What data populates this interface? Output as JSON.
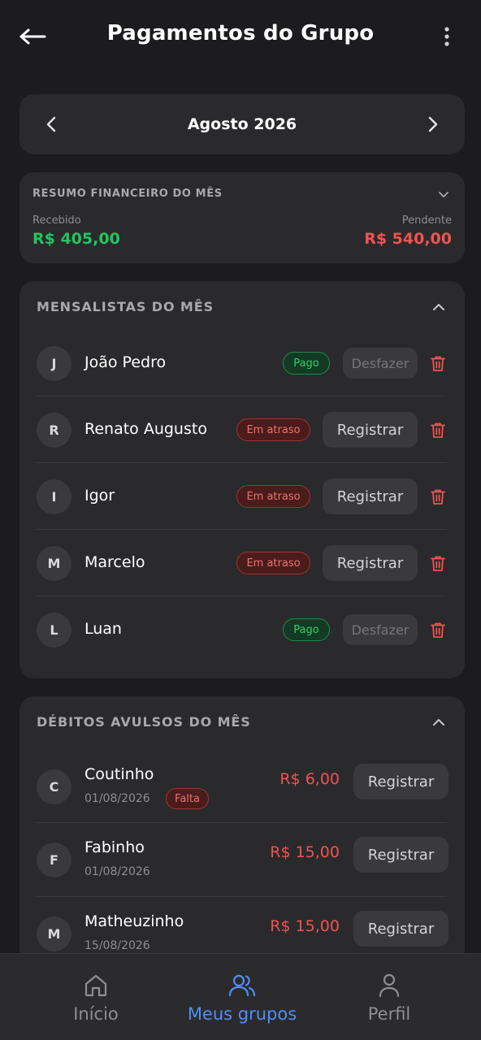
{
  "header": {
    "title": "Pagamentos do Grupo"
  },
  "month": {
    "label": "Agosto 2026"
  },
  "summary": {
    "title": "RESUMO FINANCEIRO DO MÊS",
    "received_label": "Recebido",
    "received_value": "R$ 405,00",
    "pending_label": "Pendente",
    "pending_value": "R$ 540,00"
  },
  "mensalistas": {
    "title": "MENSALISTAS DO MÊS",
    "members": [
      {
        "initial": "J",
        "name": "João Pedro",
        "status": "Pago",
        "action": "Desfazer"
      },
      {
        "initial": "R",
        "name": "Renato Augusto",
        "status": "Em atraso",
        "action": "Registrar"
      },
      {
        "initial": "I",
        "name": "Igor",
        "status": "Em atraso",
        "action": "Registrar"
      },
      {
        "initial": "M",
        "name": "Marcelo",
        "status": "Em atraso",
        "action": "Registrar"
      },
      {
        "initial": "L",
        "name": "Luan",
        "status": "Pago",
        "action": "Desfazer"
      }
    ]
  },
  "debitos": {
    "title": "DÉBITOS AVULSOS DO MÊS",
    "items": [
      {
        "initial": "C",
        "name": "Coutinho",
        "date": "01/08/2026",
        "tag": "Falta",
        "amount": "R$ 6,00",
        "action": "Registrar"
      },
      {
        "initial": "F",
        "name": "Fabinho",
        "date": "01/08/2026",
        "amount": "R$ 15,00",
        "action": "Registrar"
      },
      {
        "initial": "M",
        "name": "Matheuzinho",
        "date": "15/08/2026",
        "amount": "R$ 15,00",
        "action": "Registrar"
      }
    ]
  },
  "bottom_nav": {
    "items": [
      {
        "label": "Início",
        "icon": "home-icon"
      },
      {
        "label": "Meus grupos",
        "icon": "users-icon",
        "active": true
      },
      {
        "label": "Perfil",
        "icon": "user-icon"
      }
    ]
  },
  "colors": {
    "background": "#1c1c1e",
    "card": "#2a2a2c",
    "paid_green": "#22c55e",
    "pending_red": "#ef5350",
    "accent_blue": "#4f8ef7"
  }
}
